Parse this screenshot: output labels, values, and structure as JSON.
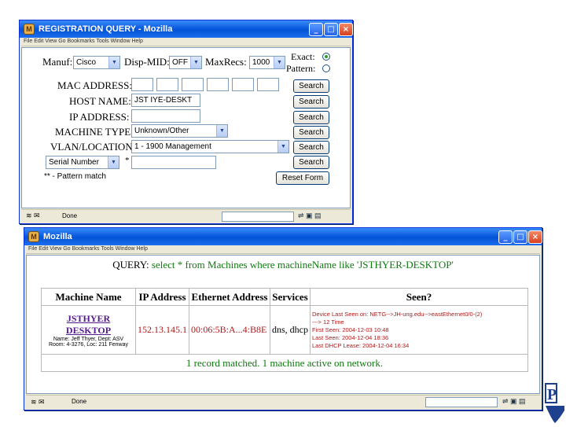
{
  "window1": {
    "title": "REGISTRATION QUERY - Mozilla",
    "menu": "File  Edit  View  Go  Bookmarks  Tools  Window  Help",
    "form": {
      "manuf_label": "Manuf:",
      "manuf_value": "Cisco",
      "disp_label": "Disp-MID:",
      "disp_value": "OFF",
      "maxrecs_label": "MaxRecs:",
      "maxrecs_value": "1000",
      "exact_label": "Exact:",
      "pattern_label": "Pattern:",
      "mac_label": "MAC ADDRESS:",
      "host_label": "HOST NAME:",
      "host_value": "JST  IYE-DESKT",
      "ip_label": "IP ADDRESS:",
      "type_label": "MACHINE TYPE:",
      "type_value": "Unknown/Other",
      "vlan_label": "VLAN/LOCATION:",
      "vlan_value": "1 - 1900 Management",
      "serial_value": "Serial Number",
      "star": "*",
      "footnote": "** - Pattern match",
      "search": "Search",
      "reset": "Reset Form"
    },
    "status": "Done"
  },
  "window2": {
    "title": "Mozilla",
    "menu": "File  Edit  View  Go  Bookmarks  Tools  Window  Help",
    "query_prefix": "QUERY:",
    "query_text": "select * from Machines where machineName like 'JSTHYER-DESKTOP'",
    "headers": [
      "Machine Name",
      "IP Address",
      "Ethernet Address",
      "Services",
      "Seen?"
    ],
    "row": {
      "name": "JSTHYER DESKTOP",
      "owner": "Name: Jeff Thyer, Dept: ASV",
      "location": "Room: 4-3276, Loc: 211 Fenway",
      "ip": "152.13.145.1",
      "mac": "00:06:5B:A...4:B8E",
      "services": "dns, dhcp",
      "seen": [
        "Device Last Seen on: NETG-->JH-ung.edu-->eastEthernet0/0-(2)",
        "---> 12 Time",
        "First Seen: 2004-12-03 10:48",
        "Last Seen: 2004-12-04 18:36",
        "Last DHCP Lease: 2004-12-04 16:34"
      ]
    },
    "summary": "1 record matched. 1 machine active on network.",
    "status": "Done"
  },
  "colors": {
    "accent_green": "#0f7a0f",
    "ip_red": "#b01818",
    "link_purple": "#551a8b",
    "titlebar_blue": "#0a5ce0"
  }
}
